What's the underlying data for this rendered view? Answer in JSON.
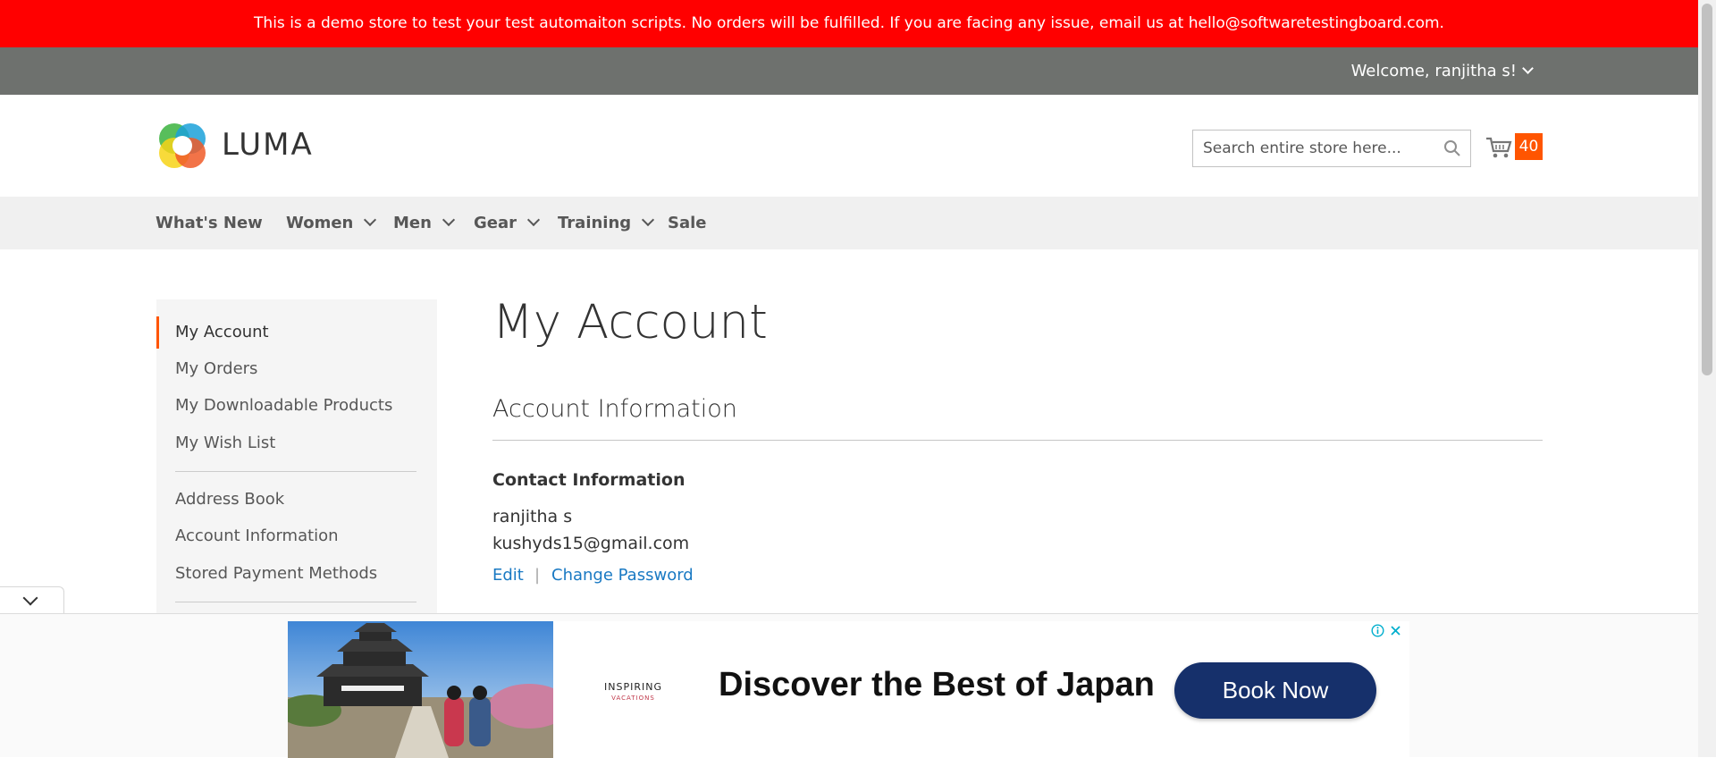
{
  "banner": {
    "text": "This is a demo store to test your test automaiton scripts. No orders will be fulfilled. If you are facing any issue, email us at hello@softwaretestingboard.com."
  },
  "topbar": {
    "welcome": "Welcome, ranjitha s!"
  },
  "header": {
    "logo_text": "LUMA",
    "search_placeholder": "Search entire store here...",
    "cart_count": "40"
  },
  "nav": {
    "items": [
      {
        "label": "What's New"
      },
      {
        "label": "Women"
      },
      {
        "label": "Men"
      },
      {
        "label": "Gear"
      },
      {
        "label": "Training"
      },
      {
        "label": "Sale"
      }
    ]
  },
  "sidebar": {
    "items": [
      {
        "label": "My Account"
      },
      {
        "label": "My Orders"
      },
      {
        "label": "My Downloadable Products"
      },
      {
        "label": "My Wish List"
      },
      {
        "label": "Address Book"
      },
      {
        "label": "Account Information"
      },
      {
        "label": "Stored Payment Methods"
      }
    ]
  },
  "main": {
    "title": "My Account",
    "section_title": "Account Information",
    "contact": {
      "heading": "Contact Information",
      "name": "ranjitha s",
      "email": "kushyds15@gmail.com",
      "edit_label": "Edit",
      "change_password_label": "Change Password"
    }
  },
  "ad": {
    "brand_line1": "INSPIRING",
    "brand_line2": "VACATIONS",
    "headline": "Discover the Best of Japan",
    "cta": "Book Now"
  },
  "colors": {
    "banner": "#ff0000",
    "topbar": "#6e716e",
    "accent": "#ff5501",
    "link": "#1979c3",
    "ad_cta": "#16306b"
  }
}
